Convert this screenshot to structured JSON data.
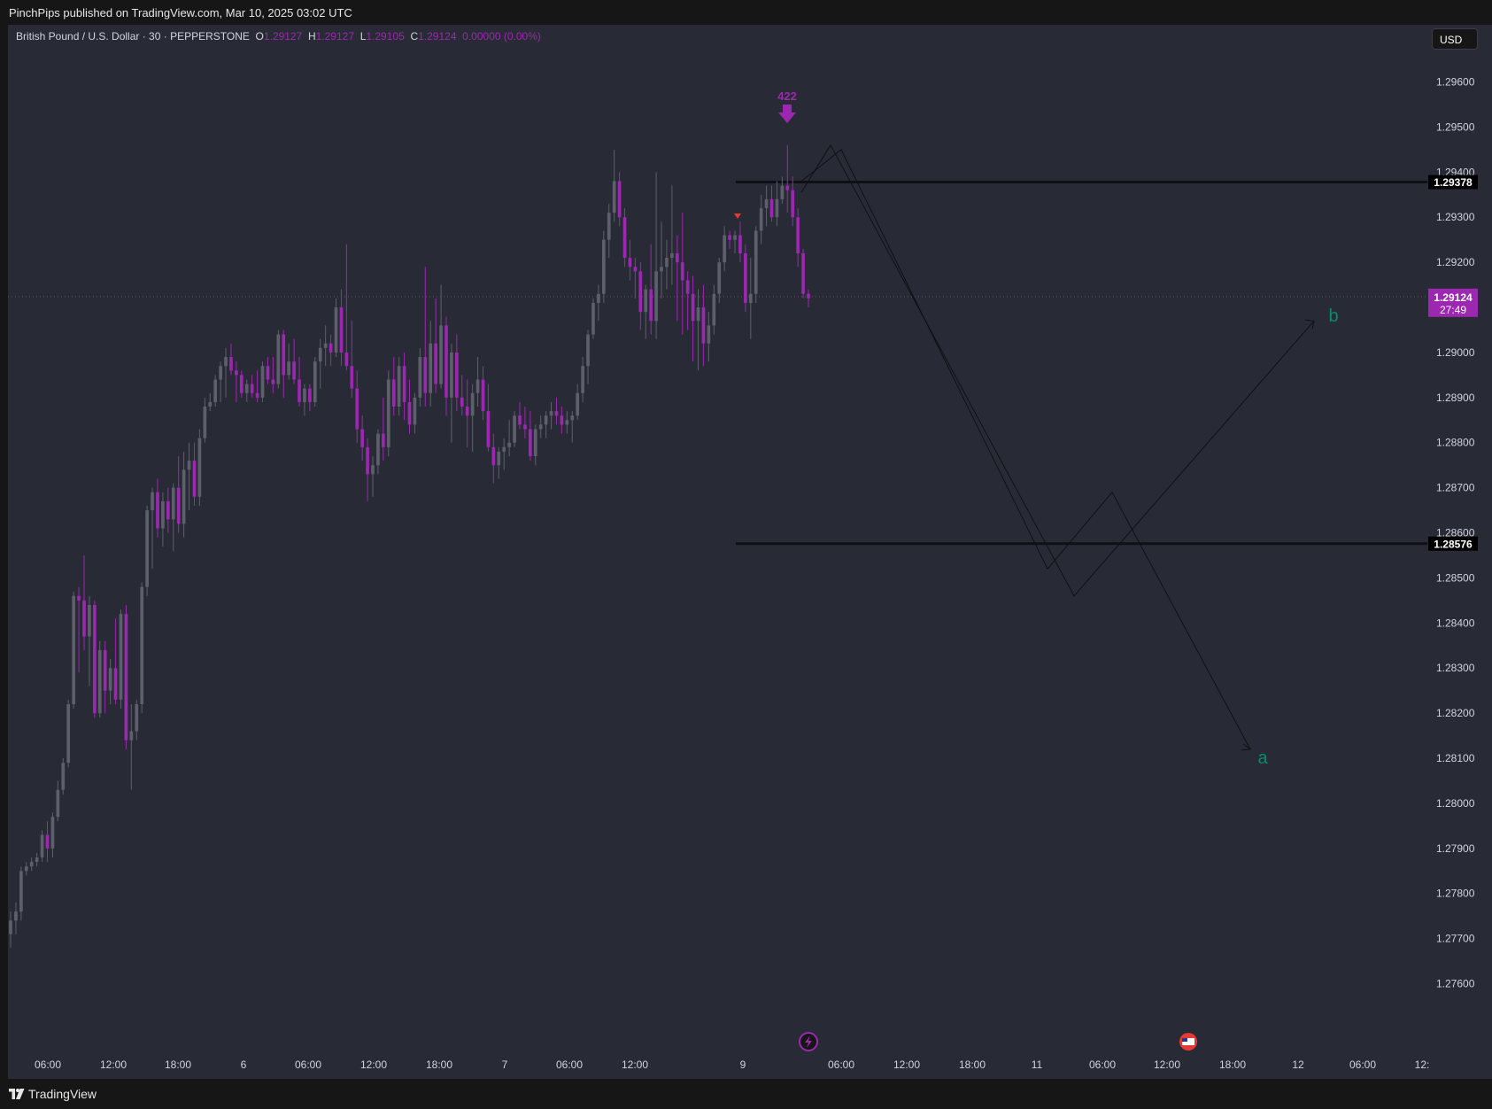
{
  "header": {
    "publisher_text": "PinchPips published on TradingView.com, Mar 10, 2025 03:02 UTC"
  },
  "legend": {
    "symbol": "British Pound / U.S. Dollar · 30 · PEPPERSTONE",
    "o_label": "O",
    "o": "1.29127",
    "h_label": "H",
    "h": "1.29127",
    "l_label": "L",
    "l": "1.29105",
    "c_label": "C",
    "c": "1.29124",
    "change": "0.00000 (0.00%)"
  },
  "currency": "USD",
  "footer": {
    "brand": "TradingView",
    "logo_icon": "tradingview-logo-icon"
  },
  "colors": {
    "background": "#282b36",
    "bull": "#5d606b",
    "bear": "#9c27b0",
    "accent": "#9c27b0",
    "wave_label": "#0b8a6e",
    "level_line": "#0e1016"
  },
  "chart_data": {
    "type": "candlestick",
    "y_min": 1.2755,
    "y_max": 1.2966,
    "y_ticks": [
      "1.29600",
      "1.29500",
      "1.29400",
      "1.29300",
      "1.29200",
      "1.29000",
      "1.28900",
      "1.28800",
      "1.28700",
      "1.28600",
      "1.28500",
      "1.28400",
      "1.28300",
      "1.28200",
      "1.28100",
      "1.28000",
      "1.27900",
      "1.27800",
      "1.27700",
      "1.27600"
    ],
    "x_ticks": [
      "06:00",
      "12:00",
      "18:00",
      "6",
      "06:00",
      "12:00",
      "18:00",
      "7",
      "06:00",
      "12:00",
      "9",
      "06:00",
      "12:00",
      "18:00",
      "11",
      "06:00",
      "12:00",
      "18:00",
      "12",
      "06:00",
      "12:"
    ],
    "horizontal_levels": [
      {
        "price": 1.29378,
        "label": "1.29378"
      },
      {
        "price": 1.28576,
        "label": "1.28576"
      }
    ],
    "last_price": {
      "price": 1.29124,
      "label": "1.29124",
      "countdown": "27:49"
    },
    "annotations": {
      "signal_count": "422",
      "wave_labels": [
        {
          "text": "b",
          "price": 1.2908
        },
        {
          "text": "a",
          "price": 1.281
        }
      ],
      "projection_channel_1": [
        [
          1.2945,
          1.2852
        ],
        [
          1.2852,
          1.2869
        ],
        [
          1.2869,
          1.2812
        ]
      ],
      "projection_channel_2": [
        [
          1.2946,
          1.2846
        ],
        [
          1.2846,
          1.2907
        ]
      ]
    },
    "candles": [
      [
        1.2771,
        1.2776,
        1.2768,
        1.2774
      ],
      [
        1.2774,
        1.2778,
        1.2771,
        1.2776
      ],
      [
        1.2776,
        1.2786,
        1.2774,
        1.2785
      ],
      [
        1.2785,
        1.2787,
        1.2784,
        1.2786
      ],
      [
        1.2786,
        1.2788,
        1.2785,
        1.2787
      ],
      [
        1.2787,
        1.2789,
        1.2786,
        1.2788
      ],
      [
        1.2788,
        1.2794,
        1.2787,
        1.2793
      ],
      [
        1.2793,
        1.2796,
        1.2787,
        1.279
      ],
      [
        1.279,
        1.2798,
        1.2788,
        1.2797
      ],
      [
        1.2797,
        1.2805,
        1.2796,
        1.2803
      ],
      [
        1.2803,
        1.281,
        1.2802,
        1.2809
      ],
      [
        1.2809,
        1.2823,
        1.2808,
        1.2822
      ],
      [
        1.2822,
        1.2847,
        1.2821,
        1.2846
      ],
      [
        1.2846,
        1.2848,
        1.2829,
        1.2845
      ],
      [
        1.2845,
        1.2855,
        1.2834,
        1.2837
      ],
      [
        1.2837,
        1.2846,
        1.2826,
        1.2844
      ],
      [
        1.2844,
        1.2845,
        1.2819,
        1.282
      ],
      [
        1.282,
        1.2836,
        1.2819,
        1.2834
      ],
      [
        1.2834,
        1.2836,
        1.282,
        1.2825
      ],
      [
        1.2825,
        1.2832,
        1.2822,
        1.283
      ],
      [
        1.283,
        1.2841,
        1.2822,
        1.2823
      ],
      [
        1.2823,
        1.2843,
        1.2821,
        1.2842
      ],
      [
        1.2842,
        1.2844,
        1.2812,
        1.2814
      ],
      [
        1.2814,
        1.2822,
        1.2803,
        1.2816
      ],
      [
        1.2816,
        1.2823,
        1.2814,
        1.2822
      ],
      [
        1.2822,
        1.2849,
        1.282,
        1.2848
      ],
      [
        1.2848,
        1.2866,
        1.2846,
        1.2865
      ],
      [
        1.2865,
        1.287,
        1.2852,
        1.2869
      ],
      [
        1.2869,
        1.2872,
        1.2859,
        1.2861
      ],
      [
        1.2861,
        1.2869,
        1.2857,
        1.2867
      ],
      [
        1.2867,
        1.287,
        1.286,
        1.2863
      ],
      [
        1.2863,
        1.2871,
        1.2856,
        1.287
      ],
      [
        1.287,
        1.2877,
        1.286,
        1.2862
      ],
      [
        1.2862,
        1.2878,
        1.2859,
        1.2874
      ],
      [
        1.2874,
        1.288,
        1.2865,
        1.2876
      ],
      [
        1.2876,
        1.288,
        1.2866,
        1.2868
      ],
      [
        1.2868,
        1.2883,
        1.2866,
        1.2881
      ],
      [
        1.2881,
        1.289,
        1.288,
        1.2888
      ],
      [
        1.2888,
        1.2891,
        1.2887,
        1.2889
      ],
      [
        1.2889,
        1.2895,
        1.2888,
        1.2894
      ],
      [
        1.2894,
        1.2898,
        1.2889,
        1.2897
      ],
      [
        1.2897,
        1.2901,
        1.289,
        1.2899
      ],
      [
        1.2899,
        1.2902,
        1.2895,
        1.2896
      ],
      [
        1.2896,
        1.2898,
        1.2889,
        1.2895
      ],
      [
        1.2895,
        1.2896,
        1.289,
        1.2891
      ],
      [
        1.2891,
        1.2894,
        1.2889,
        1.2893
      ],
      [
        1.2893,
        1.2895,
        1.289,
        1.2891
      ],
      [
        1.2891,
        1.2896,
        1.2889,
        1.289
      ],
      [
        1.289,
        1.2898,
        1.2889,
        1.2897
      ],
      [
        1.2897,
        1.2899,
        1.2893,
        1.2894
      ],
      [
        1.2894,
        1.2899,
        1.2891,
        1.2893
      ],
      [
        1.2893,
        1.2905,
        1.2892,
        1.2904
      ],
      [
        1.2904,
        1.2905,
        1.289,
        1.2895
      ],
      [
        1.2895,
        1.2902,
        1.2894,
        1.2898
      ],
      [
        1.2898,
        1.2903,
        1.2893,
        1.2894
      ],
      [
        1.2894,
        1.2899,
        1.2888,
        1.2889
      ],
      [
        1.2889,
        1.2893,
        1.2886,
        1.2892
      ],
      [
        1.2892,
        1.2893,
        1.2887,
        1.2889
      ],
      [
        1.2889,
        1.2899,
        1.2888,
        1.2898
      ],
      [
        1.2898,
        1.2903,
        1.2892,
        1.2901
      ],
      [
        1.2901,
        1.2906,
        1.2897,
        1.2902
      ],
      [
        1.2902,
        1.2904,
        1.2897,
        1.29
      ],
      [
        1.29,
        1.2912,
        1.2899,
        1.291
      ],
      [
        1.291,
        1.2914,
        1.2897,
        1.29
      ],
      [
        1.29,
        1.2924,
        1.2896,
        1.2897
      ],
      [
        1.2897,
        1.2907,
        1.289,
        1.2892
      ],
      [
        1.2892,
        1.2896,
        1.288,
        1.2883
      ],
      [
        1.2883,
        1.2886,
        1.2876,
        1.2879
      ],
      [
        1.2879,
        1.2881,
        1.2867,
        1.2873
      ],
      [
        1.2873,
        1.2877,
        1.2868,
        1.2875
      ],
      [
        1.2875,
        1.2883,
        1.2873,
        1.2882
      ],
      [
        1.2882,
        1.289,
        1.2876,
        1.2879
      ],
      [
        1.2879,
        1.2896,
        1.2877,
        1.2894
      ],
      [
        1.2894,
        1.2899,
        1.2886,
        1.2888
      ],
      [
        1.2888,
        1.2899,
        1.2886,
        1.2897
      ],
      [
        1.2897,
        1.29,
        1.2885,
        1.2889
      ],
      [
        1.2889,
        1.2894,
        1.2882,
        1.2884
      ],
      [
        1.2884,
        1.2891,
        1.2882,
        1.289
      ],
      [
        1.289,
        1.2901,
        1.2888,
        1.2899
      ],
      [
        1.2899,
        1.2919,
        1.2888,
        1.2891
      ],
      [
        1.2891,
        1.2907,
        1.2888,
        1.2902
      ],
      [
        1.2902,
        1.2912,
        1.2891,
        1.2893
      ],
      [
        1.2893,
        1.2915,
        1.2892,
        1.2906
      ],
      [
        1.2906,
        1.2908,
        1.2886,
        1.289
      ],
      [
        1.289,
        1.2902,
        1.288,
        1.29
      ],
      [
        1.29,
        1.2904,
        1.2887,
        1.289
      ],
      [
        1.289,
        1.2895,
        1.2886,
        1.2888
      ],
      [
        1.2888,
        1.2894,
        1.2879,
        1.2886
      ],
      [
        1.2886,
        1.2893,
        1.2878,
        1.2891
      ],
      [
        1.2891,
        1.2899,
        1.2888,
        1.2894
      ],
      [
        1.2894,
        1.2897,
        1.2885,
        1.2887
      ],
      [
        1.2887,
        1.2893,
        1.2878,
        1.2879
      ],
      [
        1.2879,
        1.2882,
        1.2871,
        1.2875
      ],
      [
        1.2875,
        1.2879,
        1.2872,
        1.2878
      ],
      [
        1.2878,
        1.2881,
        1.2874,
        1.2879
      ],
      [
        1.2879,
        1.2885,
        1.2877,
        1.288
      ],
      [
        1.288,
        1.2887,
        1.2879,
        1.2886
      ],
      [
        1.2886,
        1.2889,
        1.2883,
        1.2884
      ],
      [
        1.2884,
        1.2888,
        1.2881,
        1.2883
      ],
      [
        1.2883,
        1.2887,
        1.2876,
        1.2877
      ],
      [
        1.2877,
        1.2884,
        1.2875,
        1.2883
      ],
      [
        1.2883,
        1.2886,
        1.2881,
        1.2884
      ],
      [
        1.2884,
        1.2887,
        1.2881,
        1.2886
      ],
      [
        1.2886,
        1.2889,
        1.2883,
        1.2887
      ],
      [
        1.2887,
        1.289,
        1.2884,
        1.2886
      ],
      [
        1.2886,
        1.2888,
        1.2882,
        1.2884
      ],
      [
        1.2884,
        1.2887,
        1.2882,
        1.2885
      ],
      [
        1.2885,
        1.2887,
        1.288,
        1.2886
      ],
      [
        1.2886,
        1.2893,
        1.2885,
        1.2891
      ],
      [
        1.2891,
        1.2899,
        1.2889,
        1.2897
      ],
      [
        1.2897,
        1.2905,
        1.2893,
        1.2904
      ],
      [
        1.2904,
        1.2912,
        1.2903,
        1.2911
      ],
      [
        1.2911,
        1.2915,
        1.2907,
        1.2913
      ],
      [
        1.2913,
        1.2927,
        1.2911,
        1.2925
      ],
      [
        1.2925,
        1.2933,
        1.2921,
        1.2931
      ],
      [
        1.2931,
        1.2945,
        1.2929,
        1.2938
      ],
      [
        1.2938,
        1.294,
        1.2928,
        1.293
      ],
      [
        1.293,
        1.2932,
        1.2919,
        1.2921
      ],
      [
        1.2921,
        1.2925,
        1.2916,
        1.2919
      ],
      [
        1.2919,
        1.2921,
        1.2912,
        1.2918
      ],
      [
        1.2918,
        1.292,
        1.2905,
        1.2909
      ],
      [
        1.2909,
        1.2915,
        1.2903,
        1.2914
      ],
      [
        1.2914,
        1.2924,
        1.2904,
        1.2907
      ],
      [
        1.2907,
        1.294,
        1.2903,
        1.2918
      ],
      [
        1.2918,
        1.2929,
        1.2912,
        1.2919
      ],
      [
        1.2919,
        1.2925,
        1.2914,
        1.2921
      ],
      [
        1.2921,
        1.2937,
        1.2915,
        1.2922
      ],
      [
        1.2922,
        1.2926,
        1.2907,
        1.292
      ],
      [
        1.292,
        1.2931,
        1.2904,
        1.2916
      ],
      [
        1.2916,
        1.2918,
        1.2905,
        1.2913
      ],
      [
        1.2913,
        1.2917,
        1.2898,
        1.2907
      ],
      [
        1.2907,
        1.2914,
        1.2896,
        1.291
      ],
      [
        1.291,
        1.2915,
        1.2897,
        1.2902
      ],
      [
        1.2902,
        1.2909,
        1.2898,
        1.2906
      ],
      [
        1.2906,
        1.2915,
        1.2904,
        1.2913
      ],
      [
        1.2913,
        1.2921,
        1.2911,
        1.292
      ],
      [
        1.292,
        1.2928,
        1.2918,
        1.2926
      ],
      [
        1.2926,
        1.2927,
        1.2923,
        1.2925
      ],
      [
        1.2925,
        1.2927,
        1.2922,
        1.2926
      ],
      [
        1.2926,
        1.2929,
        1.292,
        1.2922
      ],
      [
        1.2922,
        1.2924,
        1.2909,
        1.2911
      ],
      [
        1.2911,
        1.2921,
        1.2903,
        1.2913
      ],
      [
        1.2913,
        1.2928,
        1.2911,
        1.2927
      ],
      [
        1.2927,
        1.2935,
        1.2924,
        1.2932
      ],
      [
        1.2932,
        1.2937,
        1.2928,
        1.2934
      ],
      [
        1.2934,
        1.2937,
        1.2929,
        1.293
      ],
      [
        1.293,
        1.2938,
        1.2928,
        1.2934
      ],
      [
        1.2934,
        1.2939,
        1.2933,
        1.2937
      ],
      [
        1.2937,
        1.2946,
        1.2931,
        1.2936
      ],
      [
        1.2936,
        1.2939,
        1.2928,
        1.293
      ],
      [
        1.293,
        1.2932,
        1.2919,
        1.2922
      ],
      [
        1.2922,
        1.2923,
        1.2912,
        1.2913
      ],
      [
        1.2913,
        1.2914,
        1.291,
        1.2912
      ]
    ]
  }
}
